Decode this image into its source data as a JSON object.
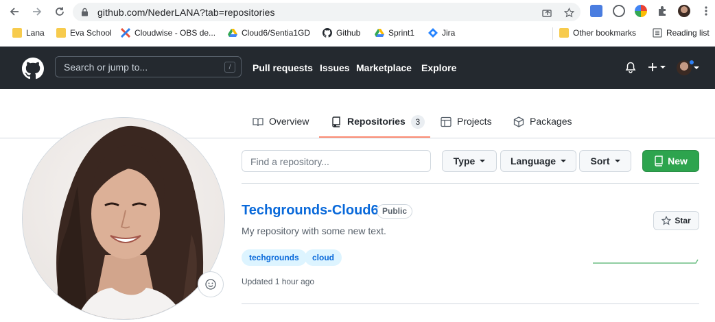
{
  "browser": {
    "url": "github.com/NederLANA?tab=repositories",
    "bookmarks": [
      {
        "label": "Lana",
        "icon": "folder-icon"
      },
      {
        "label": "Eva School",
        "icon": "folder-icon"
      },
      {
        "label": "Cloudwise - OBS de...",
        "icon": "cloudwise-icon"
      },
      {
        "label": "Cloud6/Sentia1GD",
        "icon": "google-drive-icon"
      },
      {
        "label": "Github",
        "icon": "github-icon"
      },
      {
        "label": "Sprint1",
        "icon": "google-drive-icon"
      },
      {
        "label": "Jira",
        "icon": "jira-icon"
      }
    ],
    "other_bookmarks": "Other bookmarks",
    "reading_list": "Reading list"
  },
  "header": {
    "search_placeholder": "Search or jump to...",
    "search_shortcut": "/",
    "nav": [
      "Pull requests",
      "Issues",
      "Marketplace",
      "Explore"
    ]
  },
  "tabs": [
    {
      "label": "Overview"
    },
    {
      "label": "Repositories",
      "count": "3",
      "selected": true
    },
    {
      "label": "Projects"
    },
    {
      "label": "Packages"
    }
  ],
  "filters": {
    "find_placeholder": "Find a repository...",
    "type_label": "Type",
    "language_label": "Language",
    "sort_label": "Sort",
    "new_label": "New"
  },
  "repo": {
    "name": "Techgrounds-Cloud6",
    "visibility": "Public",
    "description": "My repository with some new text.",
    "topics": [
      "techgrounds",
      "cloud"
    ],
    "updated": "Updated 1 hour ago",
    "star_label": "Star"
  },
  "colors": {
    "header_bg": "#24292f",
    "accent": "#0969da",
    "new_button": "#2da44e",
    "selected_tab_underline": "#fd8c73"
  }
}
